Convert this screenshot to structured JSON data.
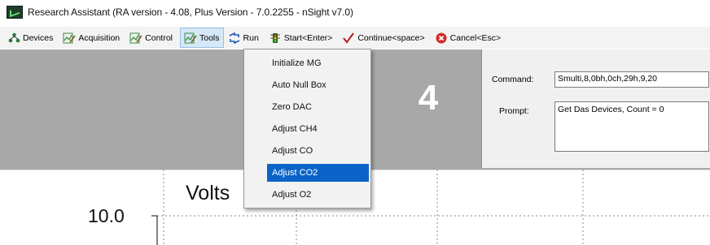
{
  "window": {
    "title": "Research Assistant (RA version - 4.08, Plus Version - 7.0.2255 - nSight v7.0)"
  },
  "toolbar": {
    "items": [
      {
        "label": "Devices",
        "icon": "devices-icon"
      },
      {
        "label": "Acquisition",
        "icon": "acquisition-icon"
      },
      {
        "label": "Control",
        "icon": "control-icon"
      },
      {
        "label": "Tools",
        "icon": "tools-icon",
        "active": true
      },
      {
        "label": "Run",
        "icon": "run-icon"
      },
      {
        "label": "Start<Enter>",
        "icon": "start-icon"
      },
      {
        "label": "Continue<space>",
        "icon": "checkmark-icon"
      },
      {
        "label": "Cancel<Esc>",
        "icon": "cancel-icon"
      }
    ]
  },
  "tools_menu": {
    "items": [
      "Initialize MG",
      "Auto Null Box",
      "Zero DAC",
      "Adjust CH4",
      "Adjust CO",
      "Adjust CO2",
      "Adjust O2"
    ],
    "selected": "Adjust CO2"
  },
  "status": {
    "big_number": "4"
  },
  "command_panel": {
    "command_label": "Command:",
    "command_value": "Smulti,8,0bh,0ch,29h,9,20",
    "prompt_label": "Prompt:",
    "prompt_value": "Get Das Devices, Count = 0"
  },
  "chart": {
    "title": "Volts",
    "y_tick_top": "10.0"
  },
  "colors": {
    "gray_band": "#a8a8a8",
    "menu_highlight": "#0a64c8",
    "toolbar_active": "#d6e7f7"
  }
}
